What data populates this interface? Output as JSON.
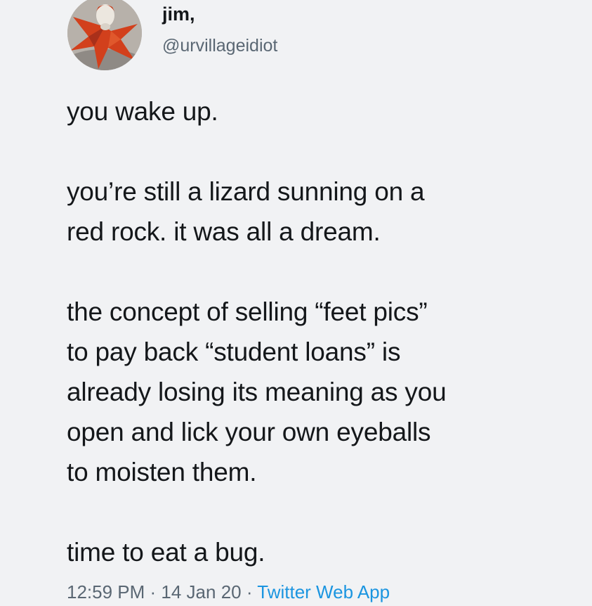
{
  "tweet": {
    "author": {
      "display_name": "jim,",
      "handle": "@urvillageidiot",
      "avatar_icon": "jester-avatar-icon"
    },
    "menu_icon": "chevron-down-icon",
    "paragraphs": [
      "you wake up.",
      "you’re still a lizard sunning on a\nred rock. it was all a dream.",
      "the concept of selling “feet pics”\nto pay back “student loans” is\nalready losing its meaning as you\nopen and lick your own eyeballs\nto moisten them.",
      "time to eat a bug."
    ],
    "meta": {
      "time": "12:59 PM",
      "separator": " · ",
      "date": "14 Jan 20",
      "source": "Twitter Web App"
    }
  },
  "colors": {
    "background": "#f1f2f4",
    "text": "#14171a",
    "secondary": "#5a6773",
    "link": "#1b95e0",
    "avatar_red": "#d2401c"
  }
}
